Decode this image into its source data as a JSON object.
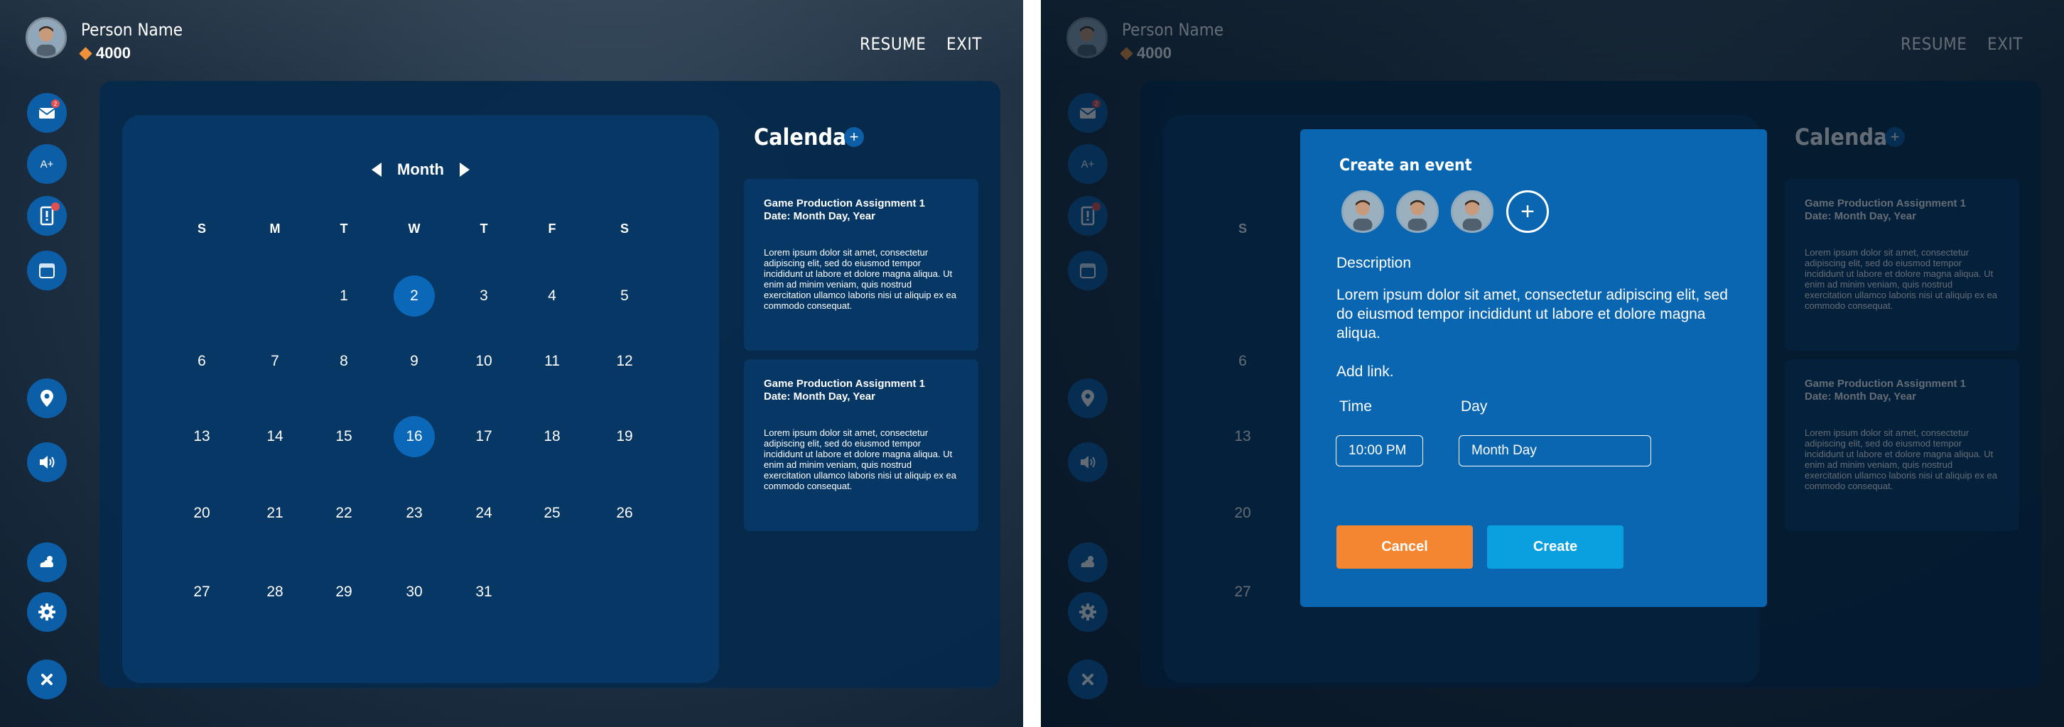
{
  "header": {
    "person_name": "Person Name",
    "coins": "4000",
    "resume_label": "RESUME",
    "exit_label": "EXIT"
  },
  "sidebar": {
    "items": [
      {
        "name": "mail-icon",
        "badge": "2"
      },
      {
        "name": "grade-icon",
        "glyph": "A+"
      },
      {
        "name": "alert-icon",
        "badge": "!"
      },
      {
        "name": "calendar-app-icon"
      },
      {
        "name": "location-pin-icon"
      },
      {
        "name": "speaker-icon"
      },
      {
        "name": "weather-icon"
      },
      {
        "name": "gear-icon"
      },
      {
        "name": "close-icon"
      }
    ]
  },
  "calendar": {
    "month_label": "Month",
    "weekdays": [
      "S",
      "M",
      "T",
      "W",
      "T",
      "F",
      "S"
    ],
    "days": [
      "1",
      "2",
      "3",
      "4",
      "5",
      "6",
      "7",
      "8",
      "9",
      "10",
      "11",
      "12",
      "13",
      "14",
      "15",
      "16",
      "17",
      "18",
      "19",
      "20",
      "21",
      "22",
      "23",
      "24",
      "25",
      "26",
      "27",
      "28",
      "29",
      "30",
      "31"
    ],
    "selected_days": [
      "2",
      "16"
    ],
    "title": "Calendar",
    "add_glyph": "+"
  },
  "events": [
    {
      "title": "Game Production Assignment 1",
      "date": "Date: Month Day, Year",
      "body": "Lorem ipsum dolor sit amet, consectetur adipiscing elit, sed do eiusmod tempor incididunt ut labore et dolore magna aliqua. Ut enim ad minim veniam, quis nostrud exercitation ullamco laboris nisi ut aliquip ex ea commodo consequat."
    },
    {
      "title": "Game Production Assignment 1",
      "date": "Date: Month Day, Year",
      "body": "Lorem ipsum dolor sit amet, consectetur adipiscing elit, sed do eiusmod tempor incididunt ut labore et dolore magna aliqua. Ut enim ad minim veniam, quis nostrud exercitation ullamco laboris nisi ut aliquip ex ea commodo consequat."
    }
  ],
  "modal": {
    "title": "Create an event",
    "add_participant_glyph": "+",
    "description_label": "Description",
    "description_text": "Lorem ipsum dolor sit amet, consectetur adipiscing elit, sed do eiusmod tempor incididunt ut labore et dolore magna aliqua.",
    "add_link_label": "Add link.",
    "time_label": "Time",
    "day_label": "Day",
    "time_value": "10:00 PM",
    "day_value": "Month Day",
    "cancel_label": "Cancel",
    "create_label": "Create"
  },
  "colors": {
    "accent": "#0c5ea7",
    "modal_bg": "#0a66b0",
    "cancel": "#f58631",
    "create": "#0aa0e0",
    "coin": "#f0923a",
    "badge": "#e05050"
  }
}
